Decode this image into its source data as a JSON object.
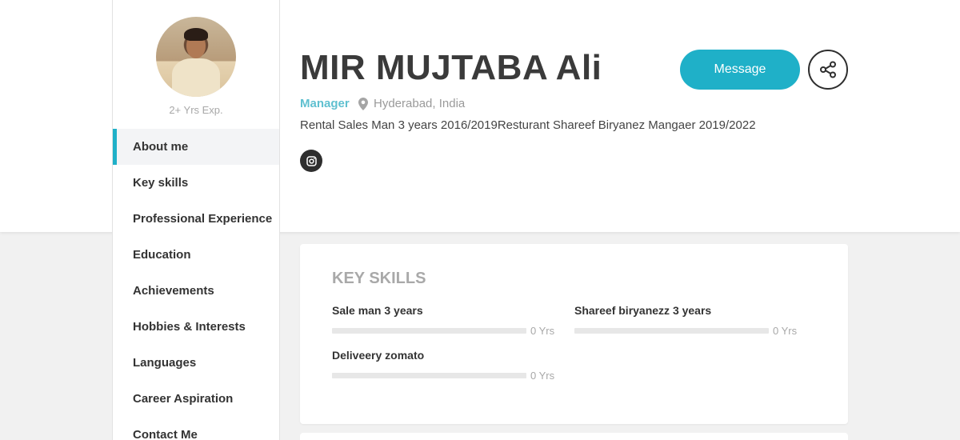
{
  "profile": {
    "experience": "2+ Yrs Exp.",
    "name": "MIR MUJTABA Ali",
    "role": "Manager",
    "location": "Hyderabad, India",
    "bio": "Rental Sales Man 3 years 2016/2019Resturant Shareef Biryanez Mangaer 2019/2022",
    "social_icon": "instagram-icon"
  },
  "actions": {
    "message_label": "Message",
    "share_icon": "share-icon"
  },
  "nav": {
    "items": [
      {
        "label": "About me",
        "active": true
      },
      {
        "label": "Key skills"
      },
      {
        "label": "Professional Experience"
      },
      {
        "label": "Education"
      },
      {
        "label": "Achievements"
      },
      {
        "label": "Hobbies & Interests"
      },
      {
        "label": "Languages"
      },
      {
        "label": "Career Aspiration"
      },
      {
        "label": "Contact Me"
      }
    ]
  },
  "key_skills": {
    "title": "KEY SKILLS",
    "skills": [
      {
        "name": "Sale man 3 years",
        "years": "0 Yrs",
        "level": 0
      },
      {
        "name": "Shareef biryanezz 3 years",
        "years": "0 Yrs",
        "level": 0
      },
      {
        "name": "Deliveery zomato",
        "years": "0 Yrs",
        "level": 0
      }
    ]
  },
  "colors": {
    "accent": "#1fb0c8",
    "role": "#5fc0d0",
    "background": "#f1f1f1"
  }
}
